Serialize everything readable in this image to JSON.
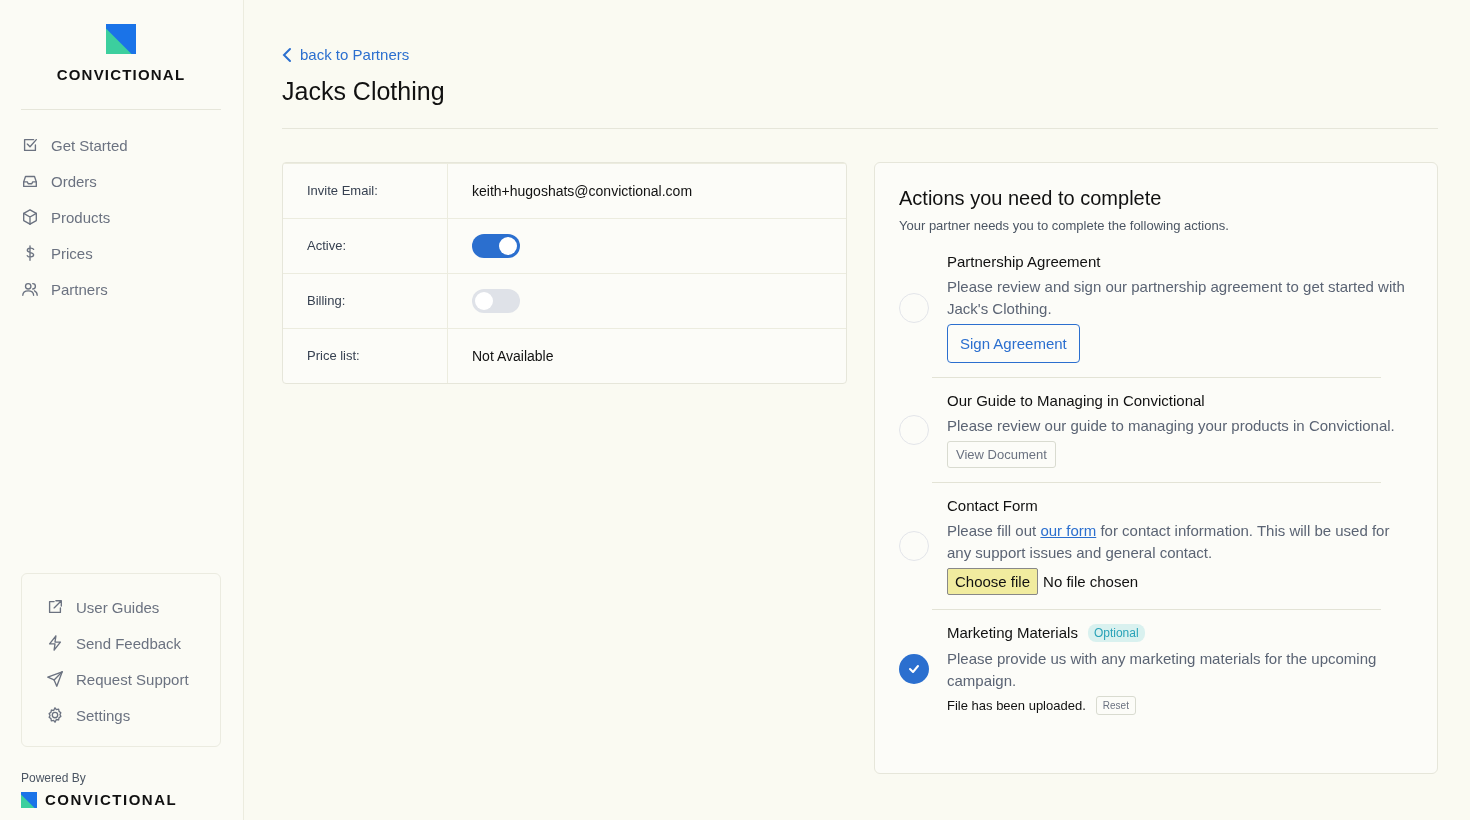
{
  "sidebar": {
    "logo_text": "CONVICTIONAL",
    "nav": [
      {
        "label": "Get Started"
      },
      {
        "label": "Orders"
      },
      {
        "label": "Products"
      },
      {
        "label": "Prices"
      },
      {
        "label": "Partners"
      }
    ],
    "help": [
      {
        "label": "User Guides"
      },
      {
        "label": "Send Feedback"
      },
      {
        "label": "Request Support"
      },
      {
        "label": "Settings"
      }
    ],
    "powered_by": "Powered By",
    "footer_logo_text": "CONVICTIONAL"
  },
  "header": {
    "back_link": "back to Partners",
    "title": "Jacks Clothing"
  },
  "details": [
    {
      "label": "Invite Email:",
      "kind": "text",
      "value": "keith+hugoshats@convictional.com"
    },
    {
      "label": "Active:",
      "kind": "toggle",
      "on": true
    },
    {
      "label": "Billing:",
      "kind": "toggle",
      "on": false
    },
    {
      "label": "Price list:",
      "kind": "text",
      "value": "Not Available"
    }
  ],
  "actions": {
    "title": "Actions you need to complete",
    "subtitle": "Your partner needs you to complete the following actions.",
    "items": [
      {
        "title": "Partnership Agreement",
        "completed": false,
        "description": [
          {
            "kind": "text",
            "text": "Please review and sign our partnership agreement to get started with Jack's Clothing."
          }
        ],
        "kind": "primary_button",
        "button": "Sign Agreement"
      },
      {
        "title": "Our Guide to Managing in Convictional",
        "completed": false,
        "description": [
          {
            "kind": "text",
            "text": "Please review our guide to managing your products in Convictional."
          }
        ],
        "kind": "secondary_button",
        "button": "View Document"
      },
      {
        "title": "Contact Form",
        "completed": false,
        "description": [
          {
            "kind": "text",
            "text": "Please fill out "
          },
          {
            "kind": "link",
            "text": "our form"
          },
          {
            "kind": "text",
            "text": " for contact information. This will be used for any support issues and general contact."
          }
        ],
        "kind": "file",
        "button": "Choose file",
        "file_status": "No file chosen"
      },
      {
        "title": "Marketing Materials",
        "badge": "Optional",
        "completed": true,
        "description": [
          {
            "kind": "text",
            "text": "Please provide us with any marketing materials for the upcoming campaign."
          }
        ],
        "kind": "uploaded",
        "status": "File has been uploaded.",
        "button": "Reset"
      }
    ]
  }
}
